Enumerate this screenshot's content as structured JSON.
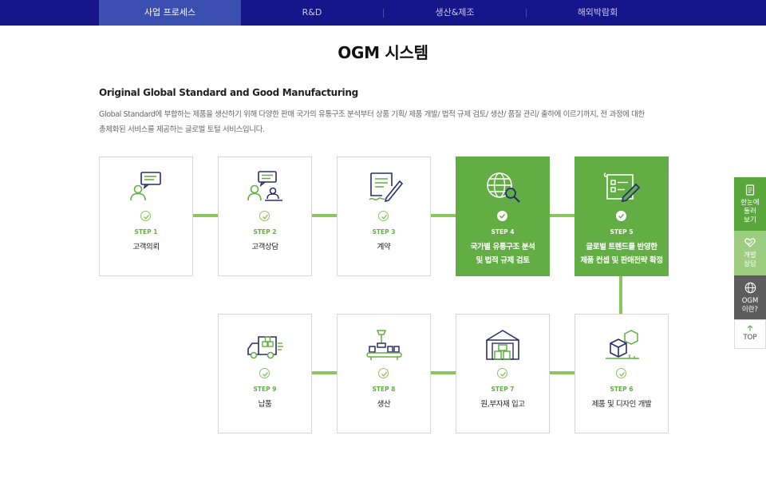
{
  "nav": {
    "tabs": [
      {
        "label": "사업 프로세스",
        "active": true
      },
      {
        "label": "R&D",
        "active": false
      },
      {
        "label": "생산&제조",
        "active": false
      },
      {
        "label": "해외박람회",
        "active": false
      }
    ]
  },
  "page": {
    "title": "OGM 시스템",
    "subtitle": "Original Global Standard and Good Manufacturing",
    "desc_line1": "Global Standard에 부합하는 제품을 생산하기 위해 다양한 판매 국가의 유통구조 분석부터 상품 기획/ 제품 개발/ 법적 규제 검토/ 생산/ 품질 관리/ 출하에 이르기까지, 전 과정에 대한",
    "desc_line2": "총체화된 서비스를 제공하는 글로벌 토털 서비스입니다."
  },
  "steps": [
    {
      "no": "STEP 1",
      "name": "고객의뢰",
      "icon": "chat-person-icon",
      "highlight": false
    },
    {
      "no": "STEP 2",
      "name": "고객상담",
      "icon": "consult-icon",
      "highlight": false
    },
    {
      "no": "STEP 3",
      "name": "계약",
      "icon": "contract-sign-icon",
      "highlight": false
    },
    {
      "no": "STEP 4",
      "name1": "국가별 유통구조 분석",
      "name2": "및 법적 규제 검토",
      "icon": "globe-search-icon",
      "highlight": true
    },
    {
      "no": "STEP 5",
      "name1": "글로벌 트렌드를 반영한",
      "name2": "제품 컨셉 및 판매전략 확정",
      "icon": "blueprint-icon",
      "highlight": true
    },
    {
      "no": "STEP 6",
      "name": "제품 및 디자인 개발",
      "icon": "box-design-icon",
      "highlight": false
    },
    {
      "no": "STEP 7",
      "name": "원,부자재 입고",
      "icon": "warehouse-icon",
      "highlight": false
    },
    {
      "no": "STEP 8",
      "name": "생산",
      "icon": "production-line-icon",
      "highlight": false
    },
    {
      "no": "STEP 9",
      "name": "납품",
      "icon": "delivery-truck-icon",
      "highlight": false
    }
  ],
  "side_menu": {
    "item1_line1": "한눈에",
    "item1_line2": "둘러",
    "item1_line3": "보기",
    "item2_line1": "개발",
    "item2_line2": "상담",
    "item3_line1": "OGM",
    "item3_line2": "이란?",
    "top_label": "TOP",
    "icons": [
      "document-icon",
      "heart-hand-icon",
      "globe-icon",
      "arrow-up-icon"
    ]
  },
  "colors": {
    "nav_bg": "#17158a",
    "nav_active": "#3a4fb0",
    "accent_green": "#63ad45",
    "line_green": "#8ac562",
    "icon_navy": "#2a2d6e"
  }
}
